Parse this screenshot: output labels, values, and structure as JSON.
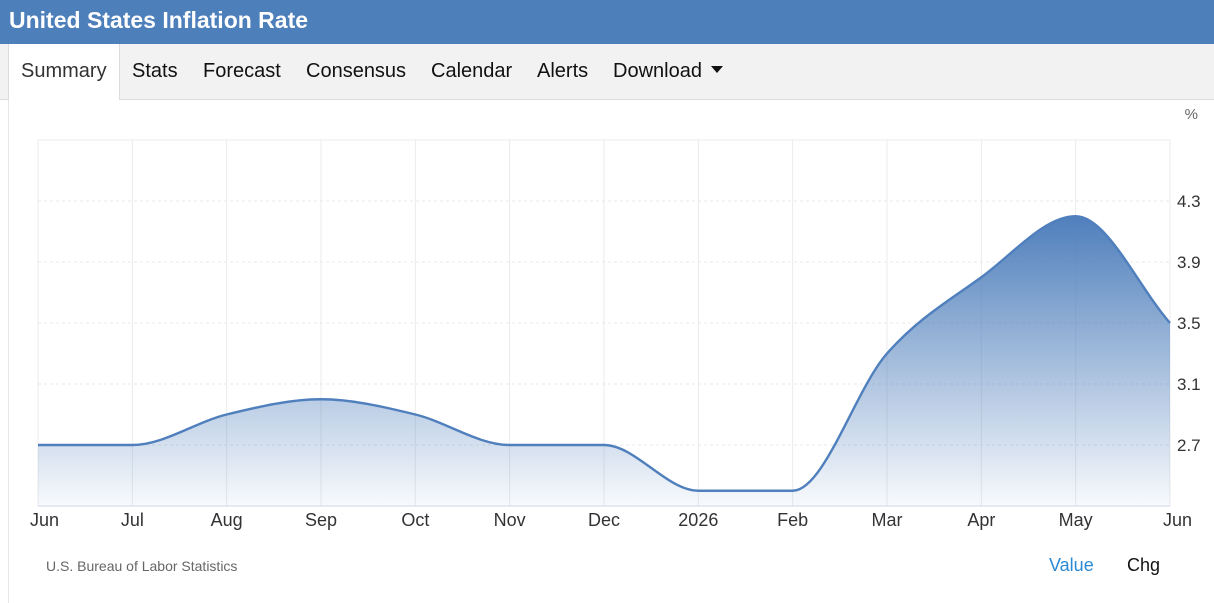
{
  "header": {
    "title": "United States Inflation Rate"
  },
  "tabs": [
    {
      "label": "Summary",
      "active": true
    },
    {
      "label": "Stats"
    },
    {
      "label": "Forecast"
    },
    {
      "label": "Consensus"
    },
    {
      "label": "Calendar"
    },
    {
      "label": "Alerts"
    },
    {
      "label": "Download",
      "has_dropdown": true
    }
  ],
  "footer": {
    "source": "U.S. Bureau of Labor Statistics",
    "value_label": "Value",
    "chg_label": "Chg"
  },
  "colors": {
    "header": "#4d7fbb",
    "line": "#4f7fbc",
    "accent": "#2a8ad6"
  },
  "chart_data": {
    "type": "area",
    "unit_label": "%",
    "x": [
      "Jun",
      "Jul",
      "Aug",
      "Sep",
      "Oct",
      "Nov",
      "Dec",
      "2026",
      "Feb",
      "Mar",
      "Apr",
      "May",
      "Jun"
    ],
    "values": [
      2.7,
      2.7,
      2.9,
      3.0,
      2.9,
      2.7,
      2.7,
      2.4,
      2.4,
      3.3,
      3.8,
      4.2,
      3.5
    ],
    "y_ticks": [
      "2.7",
      "3.1",
      "3.5",
      "3.9",
      "4.3"
    ],
    "ylim": [
      2.3,
      4.7
    ],
    "grid": true,
    "y_axis_side": "right"
  }
}
